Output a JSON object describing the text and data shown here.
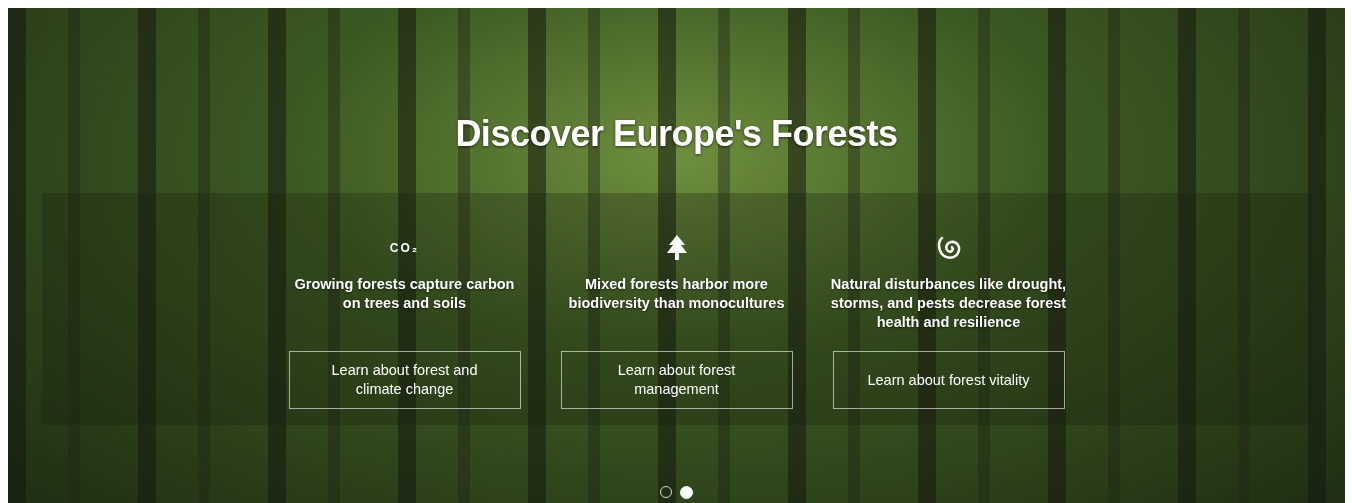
{
  "hero": {
    "title": "Discover Europe's Forests",
    "cards": [
      {
        "kind": "co2",
        "icon_text": "CO₂",
        "text": "Growing forests capture carbon on trees and soils",
        "button": "Learn about forest and climate change"
      },
      {
        "kind": "tree",
        "text": "Mixed forests harbor more biodiversity than monocultures",
        "button": "Learn about forest management"
      },
      {
        "kind": "spiral",
        "text": "Natural disturbances like drought, storms, and pests decrease forest health and resilience",
        "button": "Learn about forest vitality"
      }
    ],
    "slides": [
      {
        "selected": false
      },
      {
        "selected": true
      }
    ]
  }
}
